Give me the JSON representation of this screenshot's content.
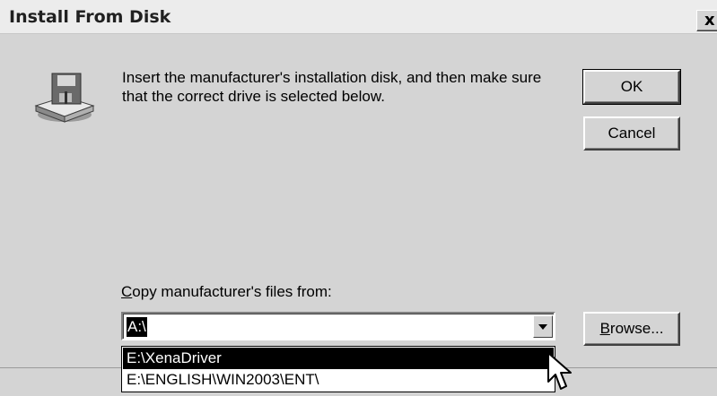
{
  "window": {
    "title": "Install From Disk",
    "close_label": "x"
  },
  "content": {
    "icon": "floppy-disk-drive-icon",
    "instructions": "Insert the manufacturer's installation disk, and then make sure that the correct drive is selected below."
  },
  "buttons": {
    "ok_label": "OK",
    "cancel_label": "Cancel",
    "browse_accel": "B",
    "browse_rest": "rowse..."
  },
  "copy_from": {
    "label_accel": "C",
    "label_rest": "opy manufacturer's files from:",
    "value": "A:\\",
    "arrow_icon": "dropdown-arrow-icon",
    "options": [
      {
        "label": "E:\\XenaDriver",
        "selected": true
      },
      {
        "label": "E:\\ENGLISH\\WIN2003\\ENT\\",
        "selected": false
      }
    ]
  },
  "cursor": "mouse-pointer-icon"
}
